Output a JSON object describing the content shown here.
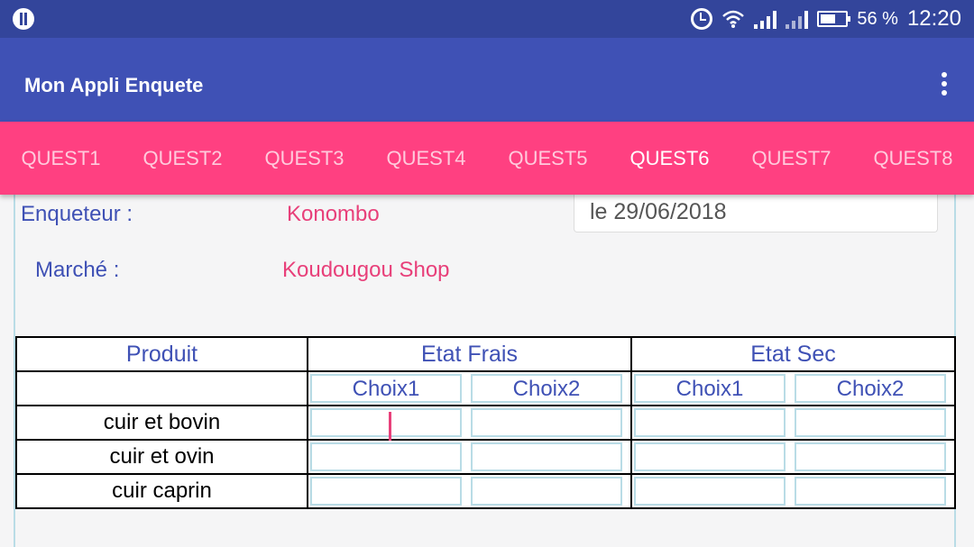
{
  "status_bar": {
    "battery_percent": "56 %",
    "time": "12:20"
  },
  "app_bar": {
    "title": "Mon Appli Enquete"
  },
  "tabs": [
    {
      "label": "QUEST1"
    },
    {
      "label": "QUEST2"
    },
    {
      "label": "QUEST3"
    },
    {
      "label": "QUEST4"
    },
    {
      "label": "QUEST5"
    },
    {
      "label": "QUEST6",
      "active": true
    },
    {
      "label": "QUEST7"
    },
    {
      "label": "QUEST8"
    }
  ],
  "form": {
    "enqueteur_label": "Enqueteur :",
    "enqueteur_value": "Konombo",
    "date_value": "le 29/06/2018",
    "marche_label": "Marché  :",
    "marche_value": "Koudougou Shop"
  },
  "table": {
    "col_produit": "Produit",
    "col_frais": "Etat Frais",
    "col_sec": "Etat Sec",
    "choix1": "Choix1",
    "choix2": "Choix2",
    "rows": [
      {
        "produit": "cuir et bovin"
      },
      {
        "produit": "cuir et ovin"
      },
      {
        "produit": "cuir caprin"
      }
    ]
  },
  "colors": {
    "status_bar": "#33459b",
    "app_bar": "#3f51b5",
    "tab_bar": "#ff4081",
    "value_text": "#e8407a"
  }
}
